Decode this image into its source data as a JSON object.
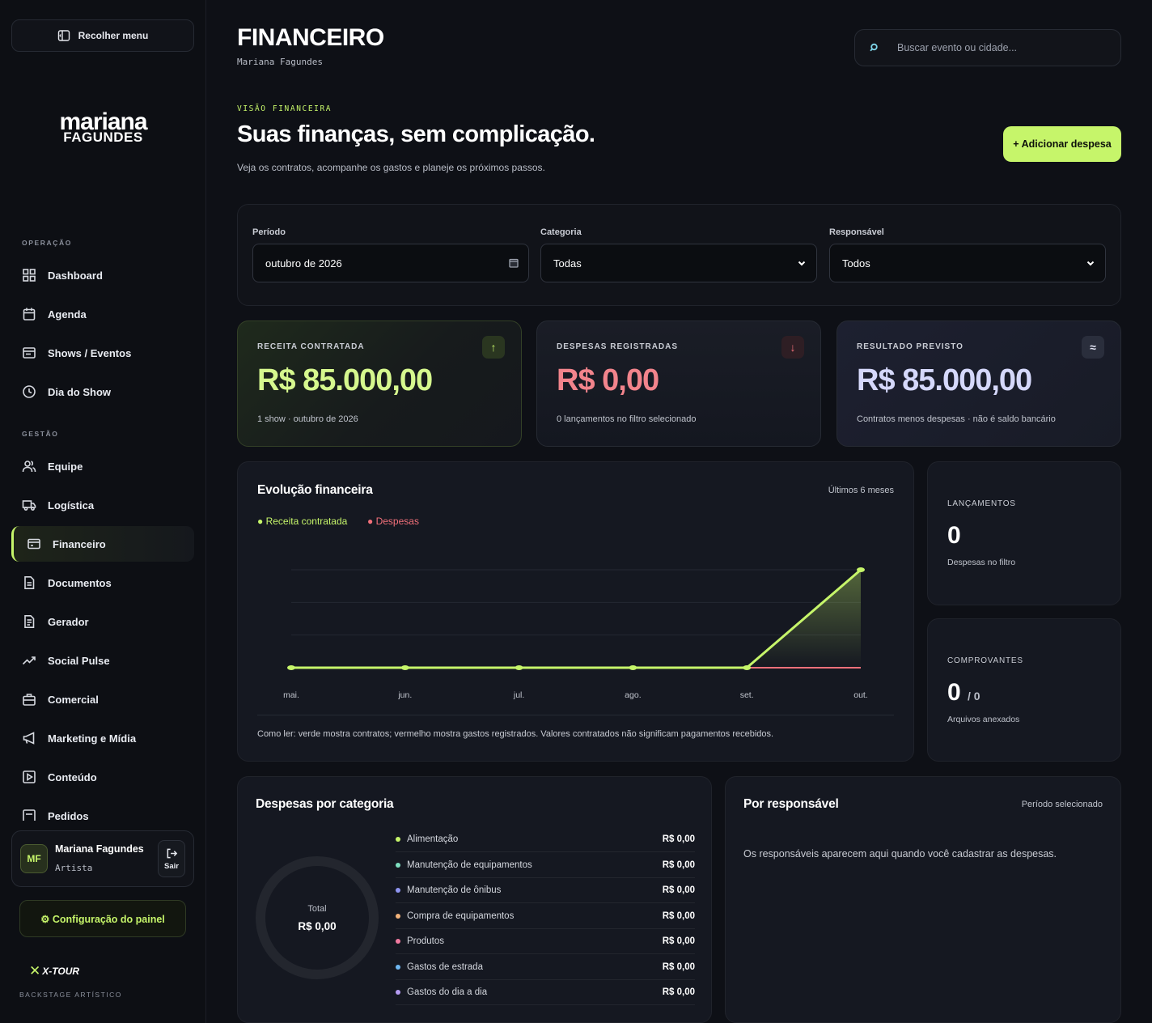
{
  "sidebar": {
    "collapse_label": "Recolher menu",
    "brand_line1": "mariana",
    "brand_line2": "FAGUNDES",
    "section_operation": "OPERAÇÃO",
    "section_management": "GESTÃO",
    "items": [
      {
        "label": "Dashboard",
        "icon": "grid-icon"
      },
      {
        "label": "Agenda",
        "icon": "calendar-icon"
      },
      {
        "label": "Shows / Eventos",
        "icon": "ticket-icon"
      },
      {
        "label": "Dia do Show",
        "icon": "clock-icon"
      },
      {
        "label": "Equipe",
        "icon": "users-icon"
      },
      {
        "label": "Logística",
        "icon": "truck-icon"
      },
      {
        "label": "Financeiro",
        "icon": "wallet-icon",
        "active": true
      },
      {
        "label": "Documentos",
        "icon": "document-icon"
      },
      {
        "label": "Gerador",
        "icon": "file-text-icon"
      },
      {
        "label": "Social Pulse",
        "icon": "trend-icon"
      },
      {
        "label": "Comercial",
        "icon": "briefcase-icon"
      },
      {
        "label": "Marketing e Mídia",
        "icon": "megaphone-icon"
      },
      {
        "label": "Conteúdo",
        "icon": "play-icon"
      },
      {
        "label": "Pedidos",
        "icon": "list-icon"
      }
    ],
    "user": {
      "initials": "MF",
      "name": "Mariana Fagundes",
      "role": "Artista",
      "logout_label": "Sair"
    },
    "config_label": "⚙ Configuração do painel",
    "footer_brand": "X-TOUR",
    "footer_tagline": "BACKSTAGE ARTÍSTICO"
  },
  "header": {
    "title": "FINANCEIRO",
    "subtitle": "Mariana Fagundes",
    "search_placeholder": "Buscar evento ou cidade..."
  },
  "hero": {
    "eyebrow": "VISÃO FINANCEIRA",
    "headline": "Suas finanças, sem complicação.",
    "lead": "Veja os contratos, acompanhe os gastos e planeje os próximos passos.",
    "add_button": "+ Adicionar despesa"
  },
  "filters": {
    "period_label": "Período",
    "period_value": "outubro de 2026",
    "category_label": "Categoria",
    "category_value": "Todas",
    "owner_label": "Responsável",
    "owner_value": "Todos"
  },
  "kpis": {
    "revenue": {
      "label": "RECEITA CONTRATADA",
      "value": "R$ 85.000,00",
      "note": "1 show · outubro de 2026",
      "icon": "arrow-up-icon"
    },
    "expenses": {
      "label": "DESPESAS REGISTRADAS",
      "value": "R$ 0,00",
      "note": "0 lançamentos no filtro selecionado",
      "icon": "arrow-down-icon"
    },
    "result": {
      "label": "RESULTADO PREVISTO",
      "value": "R$ 85.000,00",
      "note": "Contratos menos despesas · não é saldo bancário",
      "icon": "approx-icon"
    }
  },
  "evolution": {
    "title": "Evolução financeira",
    "range": "Últimos 6 meses",
    "footnote": "Como ler: verde mostra contratos; vermelho mostra gastos registrados. Valores contratados não significam pagamentos recebidos."
  },
  "chart_data": {
    "type": "line",
    "categories": [
      "mai.",
      "jun.",
      "jul.",
      "ago.",
      "set.",
      "out."
    ],
    "series": [
      {
        "name": "Receita contratada",
        "color": "#c6f56a",
        "values": [
          0,
          0,
          0,
          0,
          0,
          85000
        ]
      },
      {
        "name": "Despesas",
        "color": "#f2707a",
        "values": [
          0,
          0,
          0,
          0,
          0,
          0
        ]
      }
    ],
    "ylim": [
      0,
      85000
    ],
    "grid": true,
    "legend": "top-left"
  },
  "stats": {
    "entries": {
      "label": "LANÇAMENTOS",
      "value": "0",
      "note": "Despesas no filtro"
    },
    "receipts": {
      "label": "COMPROVANTES",
      "value": "0",
      "total": "/ 0",
      "note": "Arquivos anexados"
    }
  },
  "categories": {
    "title": "Despesas por categoria",
    "total_label": "Total",
    "total_value": "R$ 0,00",
    "rows": [
      {
        "name": "Alimentação",
        "amount": "R$ 0,00",
        "color": "#c6f56a"
      },
      {
        "name": "Manutenção de equipamentos",
        "amount": "R$ 0,00",
        "color": "#7ee0c0"
      },
      {
        "name": "Manutenção de ônibus",
        "amount": "R$ 0,00",
        "color": "#8f95f0"
      },
      {
        "name": "Compra de equipamentos",
        "amount": "R$ 0,00",
        "color": "#f2b27a"
      },
      {
        "name": "Produtos",
        "amount": "R$ 0,00",
        "color": "#f27aa0"
      },
      {
        "name": "Gastos de estrada",
        "amount": "R$ 0,00",
        "color": "#6fb8f2"
      },
      {
        "name": "Gastos do dia a dia",
        "amount": "R$ 0,00",
        "color": "#b59cf2"
      }
    ]
  },
  "by_owner": {
    "title": "Por responsável",
    "meta": "Período selecionado",
    "empty": "Os responsáveis aparecem aqui quando você cadastrar as despesas."
  }
}
